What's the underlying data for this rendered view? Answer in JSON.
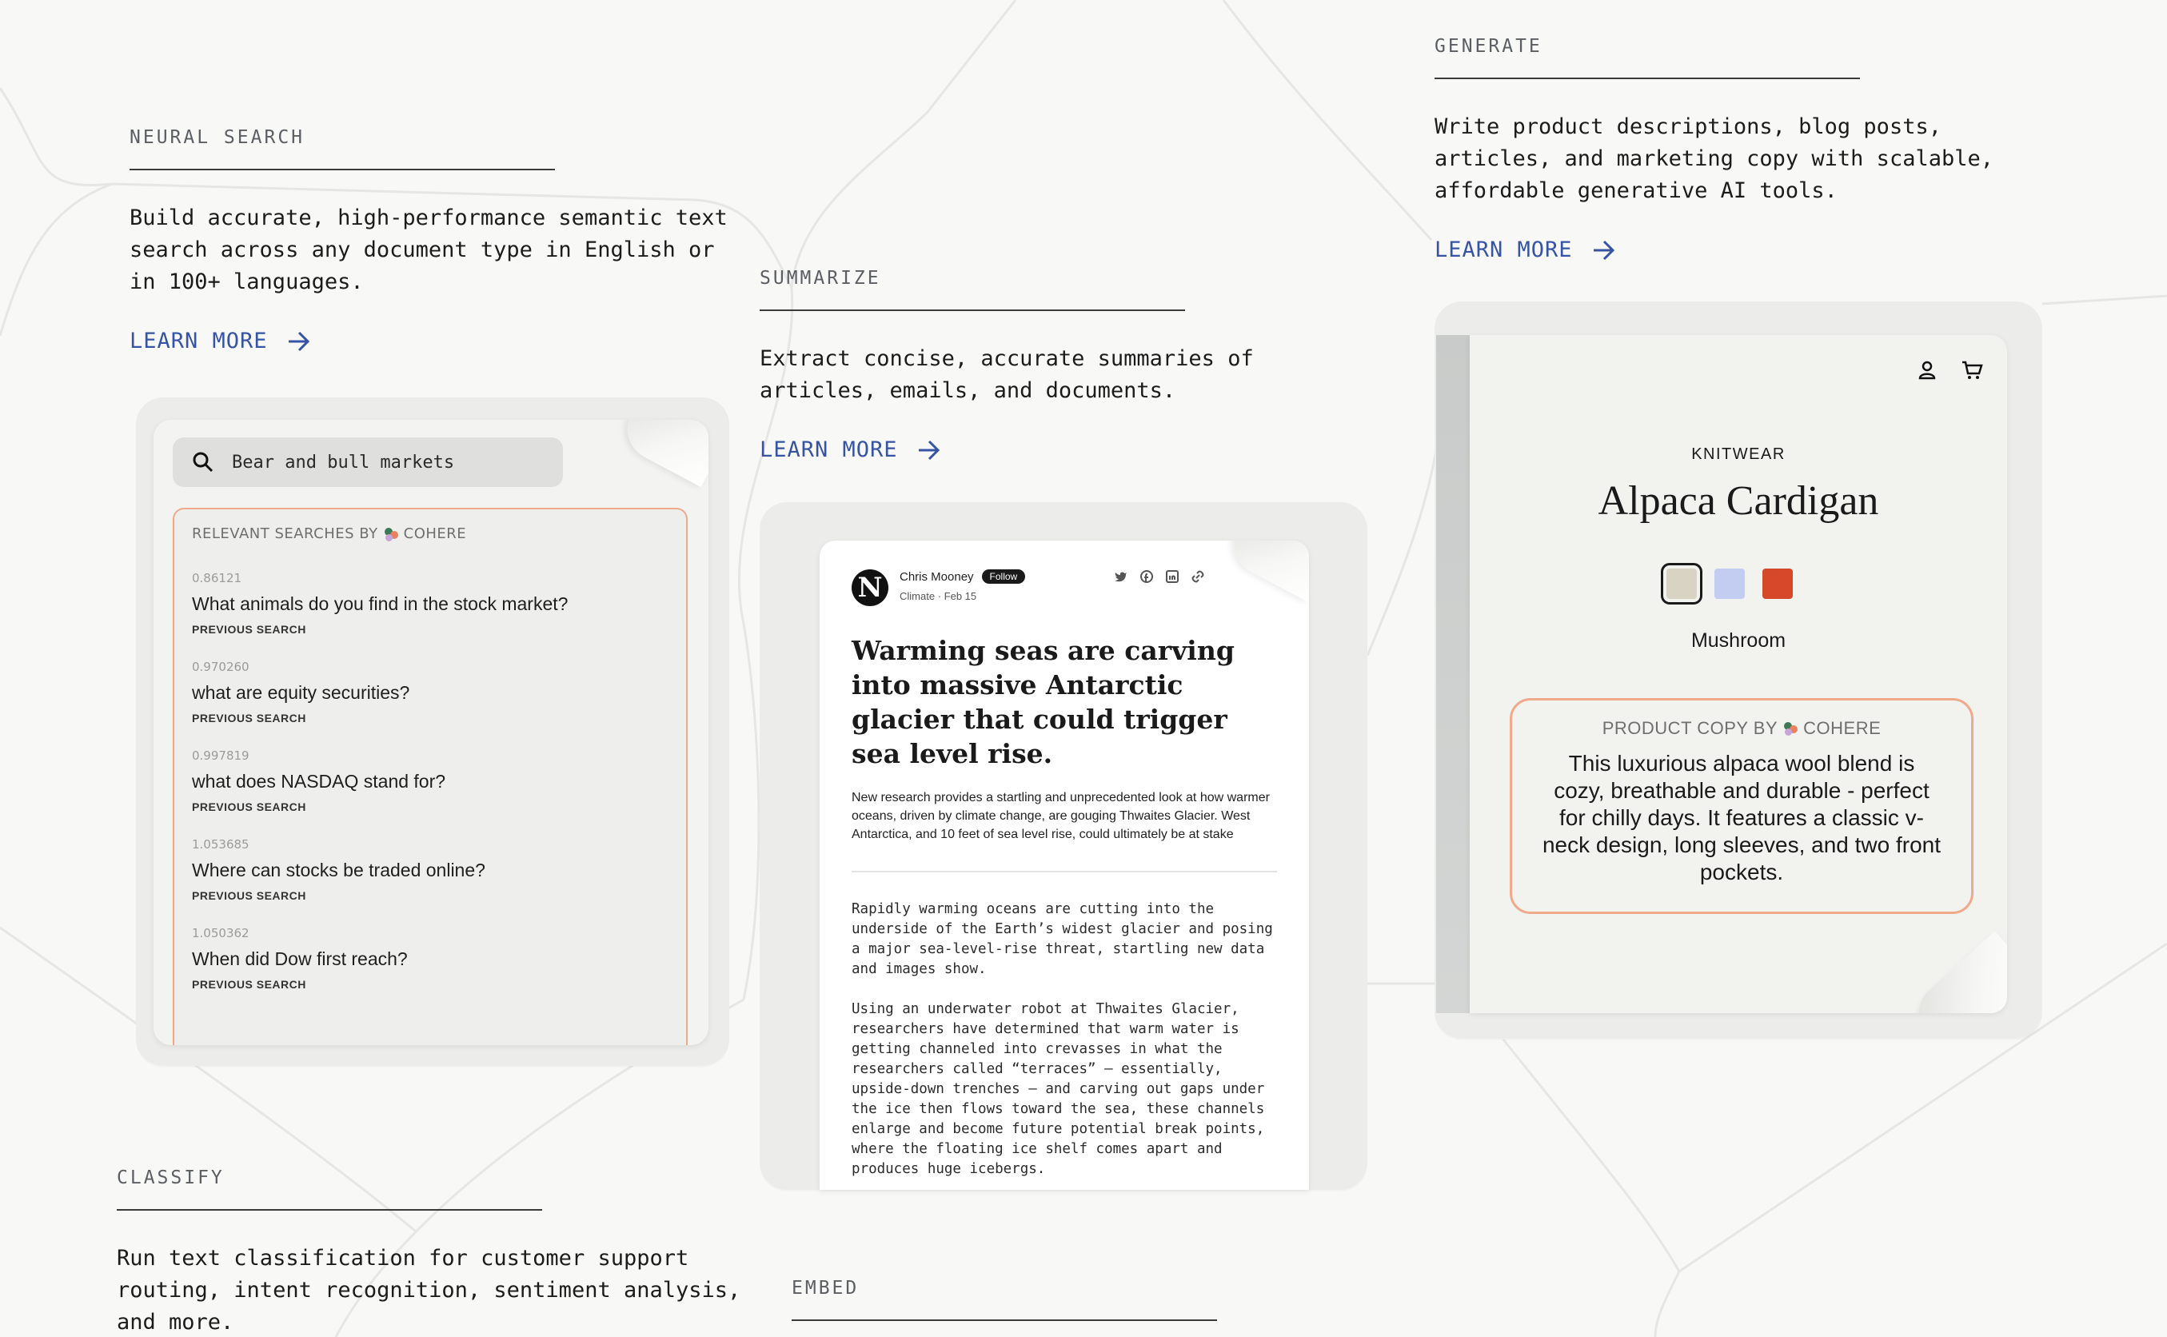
{
  "sections": {
    "search": {
      "eyebrow": "NEURAL SEARCH",
      "description": "Build accurate, high-performance semantic text search across any document type in English or in 100+ languages.",
      "cta": "LEARN MORE"
    },
    "summarize": {
      "eyebrow": "SUMMARIZE",
      "description": "Extract concise, accurate summaries of articles, emails, and documents.",
      "cta": "LEARN MORE"
    },
    "generate": {
      "eyebrow": "GENERATE",
      "description": "Write product descriptions, blog posts, articles, and marketing copy with scalable, affordable generative AI tools.",
      "cta": "LEARN MORE"
    },
    "classify": {
      "eyebrow": "CLASSIFY",
      "description": "Run text classification for customer support routing, intent recognition, sentiment analysis, and more."
    },
    "embed": {
      "eyebrow": "EMBED"
    }
  },
  "search_card": {
    "query": "Bear and bull markets",
    "results_heading_prefix": "RELEVANT SEARCHES BY",
    "brand": "COHERE",
    "results": [
      {
        "score": "0.86121",
        "text": "What animals do you find in the stock market?",
        "tag": "PREVIOUS SEARCH"
      },
      {
        "score": "0.970260",
        "text": "what are equity securities?",
        "tag": "PREVIOUS SEARCH"
      },
      {
        "score": "0.997819",
        "text": "what does NASDAQ stand for?",
        "tag": "PREVIOUS SEARCH"
      },
      {
        "score": "1.053685",
        "text": "Where can stocks be traded online?",
        "tag": "PREVIOUS SEARCH"
      },
      {
        "score": "1.050362",
        "text": "When did Dow first reach?",
        "tag": "PREVIOUS SEARCH"
      }
    ]
  },
  "article_card": {
    "logo_letter": "N",
    "author": "Chris Mooney",
    "follow_label": "Follow",
    "category": "Climate",
    "separator": "·",
    "date": "Feb 15",
    "headline": "Warming seas are carving into massive Antarctic glacier that could trigger sea level rise.",
    "dek": "New research provides a startling and unprecedented look at how warmer oceans, driven by climate change, are gouging Thwaites Glacier. West Antarctica, and 10 feet of sea level rise, could ultimately be at stake",
    "paragraphs": [
      "Rapidly warming oceans are cutting into the underside of the Earth’s widest glacier and posing a major sea-level-rise threat, startling new data and images show.",
      "Using an underwater robot at Thwaites Glacier, researchers have determined that warm water is getting channeled into crevasses in what the researchers called “terraces” – essentially, upside-down trenches – and carving out gaps under the ice then flows toward the sea, these channels enlarge and become future potential break points, where the floating ice shelf comes apart and produces huge icebergs."
    ],
    "share_icons": [
      "twitter-icon",
      "facebook-icon",
      "linkedin-icon",
      "link-icon"
    ]
  },
  "product_card": {
    "category": "KNITWEAR",
    "name": "Alpaca Cardigan",
    "swatches": [
      {
        "name": "Mushroom",
        "color": "#d9d3c4",
        "selected": true
      },
      {
        "name": "Periwinkle",
        "color": "#c3cdf2",
        "selected": false
      },
      {
        "name": "Rust",
        "color": "#d5492a",
        "selected": false
      }
    ],
    "selected_swatch": "Mushroom",
    "copy_heading_prefix": "PRODUCT COPY BY",
    "brand": "COHERE",
    "copy": "This luxurious alpaca wool blend is cozy, breathable and durable - perfect for chilly days. It features a classic v-neck design, long sleeves, and two front pockets."
  },
  "colors": {
    "accent_link": "#3654a5",
    "highlight_border": "#f1a98b",
    "background": "#f8f8f7"
  }
}
